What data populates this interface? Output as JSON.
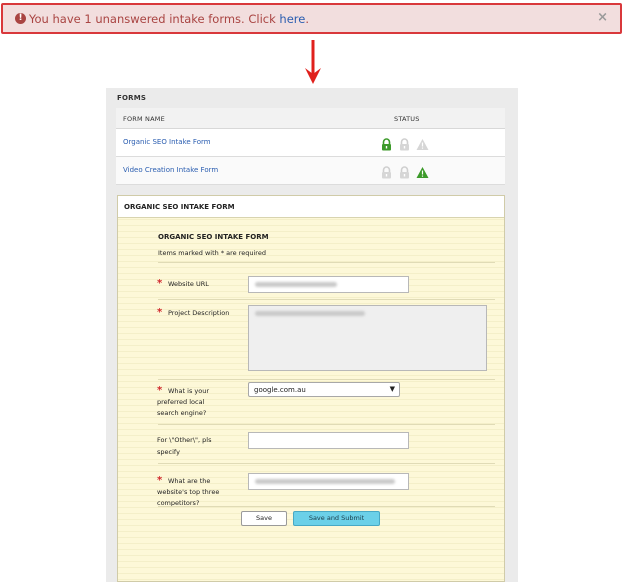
{
  "alert": {
    "text": "You have 1 unanswered intake forms. Click ",
    "link_text": "here",
    "suffix": ".",
    "close": "×"
  },
  "forms_panel": {
    "heading": "FORMS",
    "columns": {
      "name": "FORM NAME",
      "status": "STATUS"
    },
    "rows": [
      {
        "name": "Organic SEO Intake Form",
        "status": [
          "lock-open-active",
          "lock-inactive",
          "warning-inactive"
        ]
      },
      {
        "name": "Video Creation Intake Form",
        "status": [
          "lock-inactive",
          "lock-inactive",
          "warning-active"
        ]
      }
    ]
  },
  "intake": {
    "header": "ORGANIC SEO INTAKE FORM",
    "title": "ORGANIC SEO INTAKE FORM",
    "note": "Items marked with * are required",
    "required_mark": "*",
    "fields": {
      "website_url_label": "Website URL",
      "project_description_label": "Project Description",
      "search_engine_label_1": "What is your",
      "search_engine_label_2": "preferred local",
      "search_engine_label_3": "search engine?",
      "search_engine_value": "google.com.au",
      "other_label_1": "For \\\"Other\\\", pls",
      "other_label_2": "specify",
      "competitors_label_1": "What are the",
      "competitors_label_2": "website's top three",
      "competitors_label_3": "competitors?"
    },
    "buttons": {
      "save": "Save",
      "submit": "Save and Submit"
    }
  },
  "colors": {
    "alert_bg": "#f2dede",
    "alert_border": "#d9383b",
    "alert_text": "#a94442",
    "link": "#2a5db0",
    "arrow": "#e0201c",
    "active_icon": "#3c9a2a",
    "inactive_icon": "#cfcfcf",
    "submit_bg": "#6bd0e8"
  }
}
